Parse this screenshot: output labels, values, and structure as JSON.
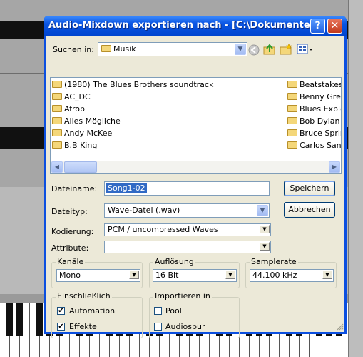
{
  "dialog": {
    "title": "Audio-Mixdown exportieren nach - [C:\\Dokumente und Ei...",
    "look_in_label": "Suchen in:",
    "look_in_value": "Musik",
    "folders_left": [
      "(1980) The Blues Brothers soundtrack",
      "AC_DC",
      "Afrob",
      "Alles Mögliche",
      "Andy McKee",
      "B.B King"
    ],
    "folders_right": [
      "Beatstakes",
      "Benny Greb",
      "Blues Explo",
      "Bob Dylan",
      "Bruce Sprin",
      "Carlos Sant"
    ],
    "filename_label": "Dateiname:",
    "filename_value": "Song1-02",
    "filetype_label": "Dateityp:",
    "filetype_value": "Wave-Datei (.wav)",
    "save_label": "Speichern",
    "cancel_label": "Abbrechen",
    "encoding_label": "Kodierung:",
    "encoding_value": "PCM / uncompressed Waves",
    "attributes_label": "Attribute:",
    "attributes_value": "",
    "channels_title": "Kanäle",
    "channels_value": "Mono",
    "resolution_title": "Auflösung",
    "resolution_value": "16 Bit",
    "samplerate_title": "Samplerate",
    "samplerate_value": "44.100 kHz",
    "include_title": "Einschließlich",
    "include_automation": "Automation",
    "include_effects": "Effekte",
    "import_title": "Importieren in",
    "import_pool": "Pool",
    "import_audio_track": "Audiospur",
    "checkmark": "✔"
  }
}
